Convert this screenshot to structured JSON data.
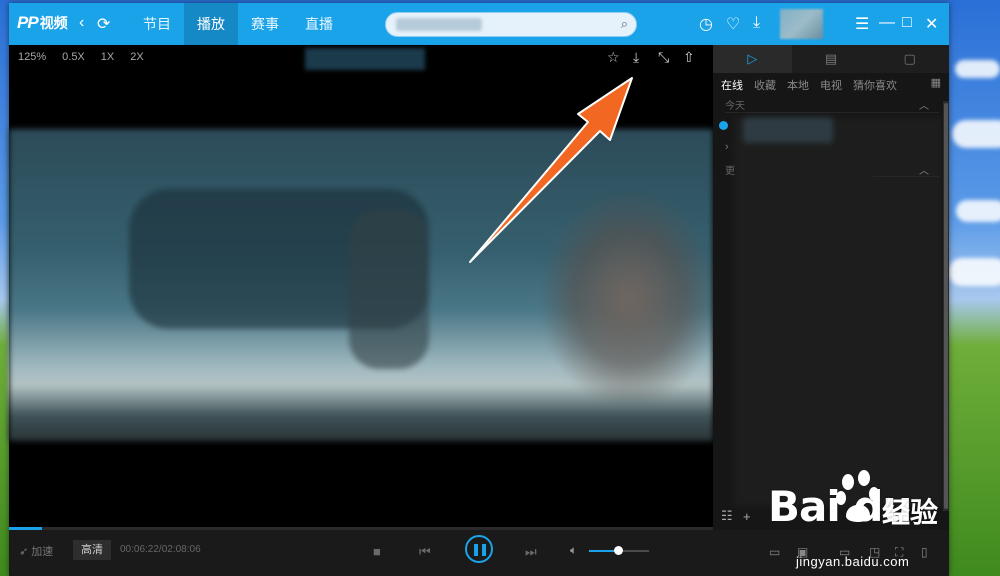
{
  "app": {
    "logo_mark": "PP",
    "logo_text": "视频"
  },
  "nav": {
    "tabs": [
      {
        "label": "节目",
        "active": false
      },
      {
        "label": "播放",
        "active": true
      },
      {
        "label": "赛事",
        "active": false
      },
      {
        "label": "直播",
        "active": false
      }
    ]
  },
  "player": {
    "zoom": "125%",
    "speeds": [
      "0.5X",
      "1X",
      "2X"
    ],
    "progress": 0.047,
    "volume": 0.55
  },
  "controls": {
    "accelerate_label": "加速",
    "quality_label": "高清",
    "timecode": "00:06:22/02:08:06"
  },
  "sidebar": {
    "subtabs": [
      "在线",
      "收藏",
      "本地",
      "电视",
      "猜你喜欢"
    ],
    "section_today": "今天",
    "section_other": "更"
  },
  "watermark": {
    "brand": "Bai du",
    "suffix": "经验",
    "url": "jingyan.baidu.com"
  },
  "colors": {
    "accent": "#1aa3e8",
    "arrow": "#f26722"
  }
}
